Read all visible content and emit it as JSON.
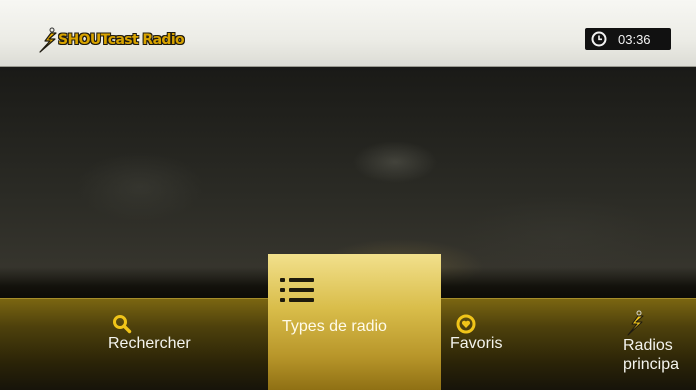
{
  "header": {
    "logo_text": "SHOUTcast Radio",
    "clock_time": "03:36",
    "icons": {
      "logo": "shoutcast-bolt-icon",
      "clock": "clock-icon"
    }
  },
  "menu": {
    "items": [
      {
        "id": "search",
        "label": "Rechercher",
        "icon": "search-icon",
        "selected": false
      },
      {
        "id": "types",
        "label": "Types de radio",
        "icon": "list-icon",
        "selected": true
      },
      {
        "id": "favorites",
        "label": "Favoris",
        "icon": "heart-icon",
        "selected": false
      },
      {
        "id": "top",
        "label_line1": "Radios",
        "label_line2": "principa",
        "icon": "shoutcast-bolt-icon",
        "selected": false
      }
    ]
  },
  "colors": {
    "accent_gold": "#d9bd4a",
    "menu_bar": "#4e410c",
    "logo_text": "#d8a300",
    "clock_bg": "#111111"
  }
}
